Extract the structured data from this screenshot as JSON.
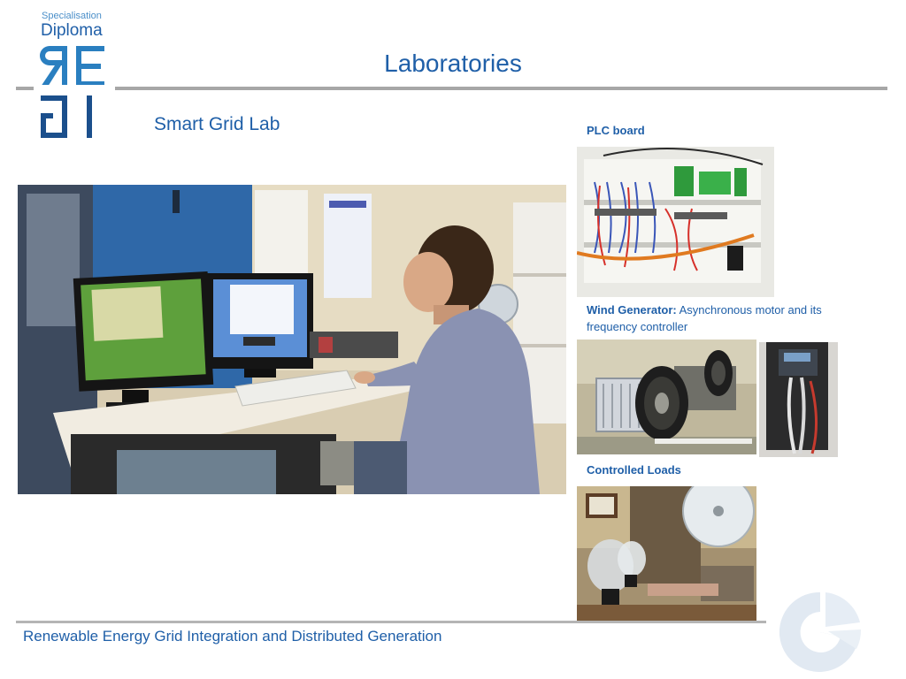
{
  "logo": {
    "line1": "Specialisation",
    "line2": "Diploma",
    "letters": "REGI"
  },
  "title": "Laboratories",
  "subtitle": "Smart Grid Lab",
  "captions": {
    "plc": "PLC board",
    "wind_bold": "Wind Generator:",
    "wind_rest": " Asynchronous motor  and its frequency controller",
    "loads": "Controlled Loads"
  },
  "footer": "Renewable Energy Grid Integration and Distributed Generation",
  "colors": {
    "accent": "#1f5fa8",
    "light_accent": "#4b8fc9",
    "rule": "#a7a7a7",
    "watermark": "#dfe8f1"
  },
  "icons": {
    "watermark": "pie-chart-logo-icon"
  }
}
